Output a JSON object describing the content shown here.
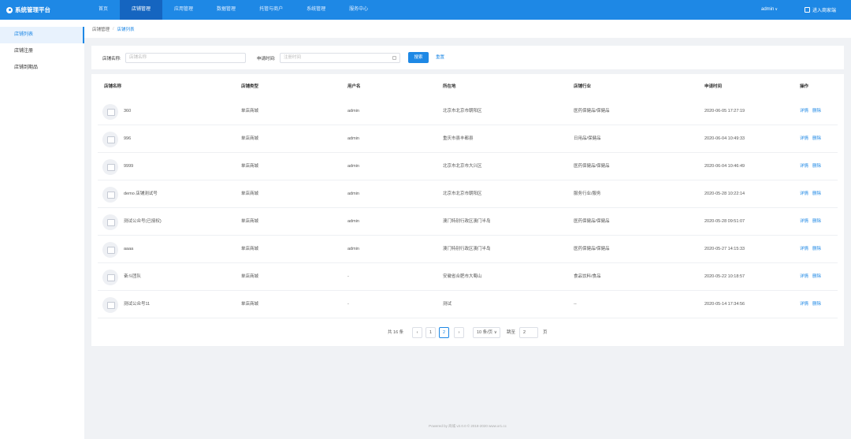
{
  "app": {
    "title": "系统管理平台",
    "logo_icon": "gear-logo-icon"
  },
  "nav": [
    {
      "label": "首页",
      "active": false
    },
    {
      "label": "店铺管理",
      "active": true
    },
    {
      "label": "应用管理",
      "active": false
    },
    {
      "label": "数据管理",
      "active": false
    },
    {
      "label": "托管与商户",
      "active": false
    },
    {
      "label": "系统管理",
      "active": false
    },
    {
      "label": "服务中心",
      "active": false
    }
  ],
  "user": {
    "name": "admin"
  },
  "store_entry": {
    "label": "进入商家端"
  },
  "sidebar": [
    {
      "label": "店铺列表",
      "active": true
    },
    {
      "label": "店铺注册",
      "active": false
    },
    {
      "label": "店铺到期品",
      "active": false
    }
  ],
  "breadcrumb": {
    "parent": "店铺管理",
    "sep": "/",
    "current": "店铺列表"
  },
  "search": {
    "name_label": "店铺名称:",
    "name_placeholder": "店铺名称",
    "date_label": "申请时间:",
    "date_placeholder": "注册时间",
    "search_button": "搜索",
    "reset_button": "重置"
  },
  "table": {
    "headers": [
      "店铺名称",
      "店铺类型",
      "用户名",
      "所在地",
      "店铺行业",
      "申请时间",
      "操作"
    ],
    "rows": [
      {
        "name": "360",
        "type": "单店商城",
        "user": "admin",
        "location": "北京市北京市朝阳区",
        "industry": "医药保健品/保健品",
        "time": "2020-06-05 17:27:19"
      },
      {
        "name": "996",
        "type": "单店商城",
        "user": "admin",
        "location": "重庆市县丰都县",
        "industry": "日用品/保健品",
        "time": "2020-06-04 10:49:33"
      },
      {
        "name": "9999",
        "type": "单店商城",
        "user": "admin",
        "location": "北京市北京市大兴区",
        "industry": "医药保健品/保健品",
        "time": "2020-06-04 10:46:49"
      },
      {
        "name": "demo 店铺测试号",
        "type": "单店商城",
        "user": "admin",
        "location": "北京市北京市朝阳区",
        "industry": "服务行业/服务",
        "time": "2020-05-28 10:22:14"
      },
      {
        "name": "测试公众号(已授权)",
        "type": "单店商城",
        "user": "admin",
        "location": "澳门特别行政区澳门半岛",
        "industry": "医药保健品/保健品",
        "time": "2020-05-28 09:51:07"
      },
      {
        "name": "aaaa",
        "type": "单店商城",
        "user": "admin",
        "location": "澳门特别行政区澳门半岛",
        "industry": "医药保健品/保健品",
        "time": "2020-05-27 14:15:33"
      },
      {
        "name": "奋斗团队",
        "type": "单店商城",
        "user": "-",
        "location": "安徽省合肥市大蜀山",
        "industry": "食品饮料/食品",
        "time": "2020-05-22 10:18:57"
      },
      {
        "name": "测试公众号11",
        "type": "单店商城",
        "user": "-",
        "location": "测试",
        "industry": "--",
        "time": "2020-05-14 17:34:56"
      }
    ],
    "op_detail": "详情",
    "op_delete": "删除"
  },
  "pagination": {
    "total": "共 16 条",
    "prev": "‹",
    "next": "›",
    "pages": [
      "1",
      "2"
    ],
    "current_page": "2",
    "page_size": "10 条/页",
    "jump_label": "跳至",
    "jump_value": "2",
    "jump_unit": "页"
  },
  "footer": {
    "text": "Powered by 商城 v2.0.0 © 2018-2020 www.xr1.cc"
  },
  "colors": {
    "primary": "#1e88e5",
    "nav_active": "#1565c0",
    "background": "#f0f2f5"
  }
}
